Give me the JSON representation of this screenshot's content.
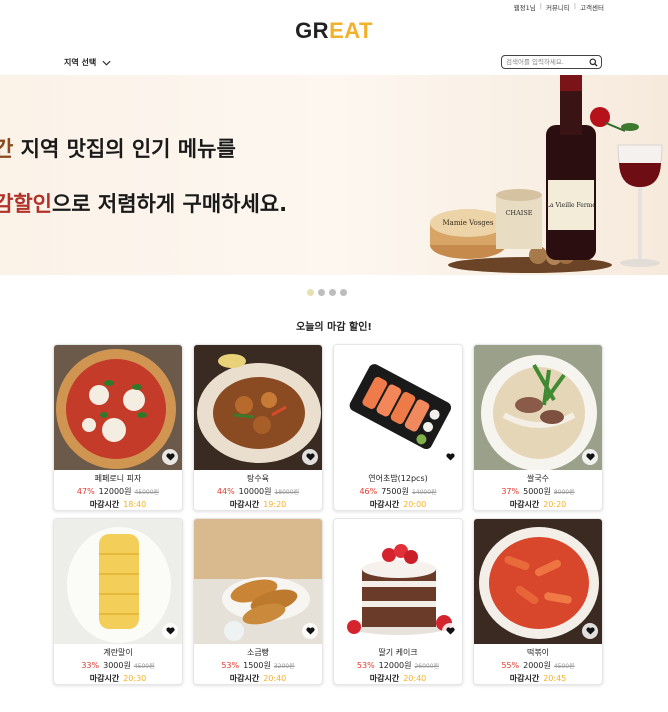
{
  "header": {
    "util_links": [
      "웹정1님",
      "커뮤니티",
      "고객센터"
    ],
    "logo_prefix": "GR",
    "logo_suffix": "EAT",
    "region_label": "지역 선택",
    "search_placeholder": "검색어를 입력하세요."
  },
  "banner": {
    "line1_highlight": "간",
    "line1_rest": " 지역 맛집의 인기 메뉴를",
    "line2_highlight": "감할인",
    "line2_rest": "으로 저렴하게 구매하세요.",
    "cheese_label": "Mamie Vosges",
    "box_label": "CHAISE",
    "wine_label": "La Vieille Ferme",
    "dots": [
      true,
      false,
      false,
      false
    ]
  },
  "section_title": "오늘의 마감 할인!",
  "close_label": "마감시간",
  "products": [
    {
      "name": "페페로니 피자",
      "discount": "47%",
      "price": "12000원",
      "original": "45000원",
      "time": "18:40",
      "icon": "heart-icon"
    },
    {
      "name": "탕수육",
      "discount": "44%",
      "price": "10000원",
      "original": "18000원",
      "time": "19:20",
      "icon": "heart-icon"
    },
    {
      "name": "연어초밥(12pcs)",
      "discount": "46%",
      "price": "7500원",
      "original": "14000원",
      "time": "20:00",
      "icon": "heart-icon"
    },
    {
      "name": "쌀국수",
      "discount": "37%",
      "price": "5000원",
      "original": "8000원",
      "time": "20:20",
      "icon": "heart-icon"
    },
    {
      "name": "계란말이",
      "discount": "33%",
      "price": "3000원",
      "original": "4500원",
      "time": "20:30",
      "icon": "heart-icon"
    },
    {
      "name": "소금빵",
      "discount": "53%",
      "price": "1500원",
      "original": "3200원",
      "time": "20:40",
      "icon": "heart-icon"
    },
    {
      "name": "딸기 케이크",
      "discount": "53%",
      "price": "12000원",
      "original": "26000원",
      "time": "20:40",
      "icon": "heart-icon"
    },
    {
      "name": "떡볶이",
      "discount": "55%",
      "price": "2000원",
      "original": "4500원",
      "time": "20:45",
      "icon": "heart-icon"
    }
  ],
  "colors": {
    "accent": "#f2b12a",
    "discount": "#e53a2f",
    "banner_bg": "#fbf2e8"
  }
}
